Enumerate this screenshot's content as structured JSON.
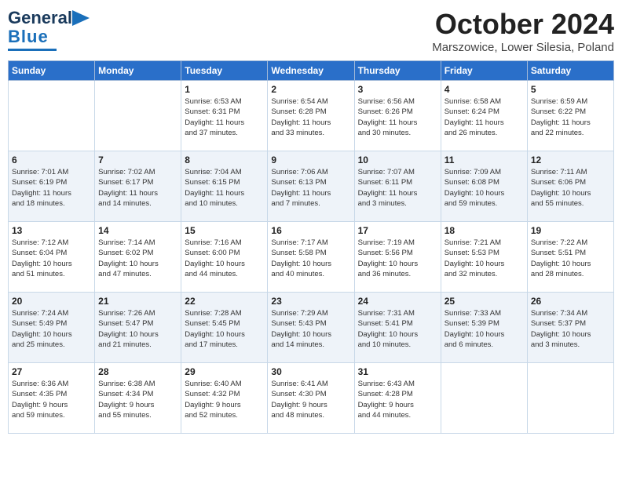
{
  "header": {
    "logo_line1": "General",
    "logo_line2": "Blue",
    "month": "October 2024",
    "location": "Marszowice, Lower Silesia, Poland"
  },
  "weekdays": [
    "Sunday",
    "Monday",
    "Tuesday",
    "Wednesday",
    "Thursday",
    "Friday",
    "Saturday"
  ],
  "weeks": [
    [
      {
        "day": "",
        "info": ""
      },
      {
        "day": "",
        "info": ""
      },
      {
        "day": "1",
        "info": "Sunrise: 6:53 AM\nSunset: 6:31 PM\nDaylight: 11 hours\nand 37 minutes."
      },
      {
        "day": "2",
        "info": "Sunrise: 6:54 AM\nSunset: 6:28 PM\nDaylight: 11 hours\nand 33 minutes."
      },
      {
        "day": "3",
        "info": "Sunrise: 6:56 AM\nSunset: 6:26 PM\nDaylight: 11 hours\nand 30 minutes."
      },
      {
        "day": "4",
        "info": "Sunrise: 6:58 AM\nSunset: 6:24 PM\nDaylight: 11 hours\nand 26 minutes."
      },
      {
        "day": "5",
        "info": "Sunrise: 6:59 AM\nSunset: 6:22 PM\nDaylight: 11 hours\nand 22 minutes."
      }
    ],
    [
      {
        "day": "6",
        "info": "Sunrise: 7:01 AM\nSunset: 6:19 PM\nDaylight: 11 hours\nand 18 minutes."
      },
      {
        "day": "7",
        "info": "Sunrise: 7:02 AM\nSunset: 6:17 PM\nDaylight: 11 hours\nand 14 minutes."
      },
      {
        "day": "8",
        "info": "Sunrise: 7:04 AM\nSunset: 6:15 PM\nDaylight: 11 hours\nand 10 minutes."
      },
      {
        "day": "9",
        "info": "Sunrise: 7:06 AM\nSunset: 6:13 PM\nDaylight: 11 hours\nand 7 minutes."
      },
      {
        "day": "10",
        "info": "Sunrise: 7:07 AM\nSunset: 6:11 PM\nDaylight: 11 hours\nand 3 minutes."
      },
      {
        "day": "11",
        "info": "Sunrise: 7:09 AM\nSunset: 6:08 PM\nDaylight: 10 hours\nand 59 minutes."
      },
      {
        "day": "12",
        "info": "Sunrise: 7:11 AM\nSunset: 6:06 PM\nDaylight: 10 hours\nand 55 minutes."
      }
    ],
    [
      {
        "day": "13",
        "info": "Sunrise: 7:12 AM\nSunset: 6:04 PM\nDaylight: 10 hours\nand 51 minutes."
      },
      {
        "day": "14",
        "info": "Sunrise: 7:14 AM\nSunset: 6:02 PM\nDaylight: 10 hours\nand 47 minutes."
      },
      {
        "day": "15",
        "info": "Sunrise: 7:16 AM\nSunset: 6:00 PM\nDaylight: 10 hours\nand 44 minutes."
      },
      {
        "day": "16",
        "info": "Sunrise: 7:17 AM\nSunset: 5:58 PM\nDaylight: 10 hours\nand 40 minutes."
      },
      {
        "day": "17",
        "info": "Sunrise: 7:19 AM\nSunset: 5:56 PM\nDaylight: 10 hours\nand 36 minutes."
      },
      {
        "day": "18",
        "info": "Sunrise: 7:21 AM\nSunset: 5:53 PM\nDaylight: 10 hours\nand 32 minutes."
      },
      {
        "day": "19",
        "info": "Sunrise: 7:22 AM\nSunset: 5:51 PM\nDaylight: 10 hours\nand 28 minutes."
      }
    ],
    [
      {
        "day": "20",
        "info": "Sunrise: 7:24 AM\nSunset: 5:49 PM\nDaylight: 10 hours\nand 25 minutes."
      },
      {
        "day": "21",
        "info": "Sunrise: 7:26 AM\nSunset: 5:47 PM\nDaylight: 10 hours\nand 21 minutes."
      },
      {
        "day": "22",
        "info": "Sunrise: 7:28 AM\nSunset: 5:45 PM\nDaylight: 10 hours\nand 17 minutes."
      },
      {
        "day": "23",
        "info": "Sunrise: 7:29 AM\nSunset: 5:43 PM\nDaylight: 10 hours\nand 14 minutes."
      },
      {
        "day": "24",
        "info": "Sunrise: 7:31 AM\nSunset: 5:41 PM\nDaylight: 10 hours\nand 10 minutes."
      },
      {
        "day": "25",
        "info": "Sunrise: 7:33 AM\nSunset: 5:39 PM\nDaylight: 10 hours\nand 6 minutes."
      },
      {
        "day": "26",
        "info": "Sunrise: 7:34 AM\nSunset: 5:37 PM\nDaylight: 10 hours\nand 3 minutes."
      }
    ],
    [
      {
        "day": "27",
        "info": "Sunrise: 6:36 AM\nSunset: 4:35 PM\nDaylight: 9 hours\nand 59 minutes."
      },
      {
        "day": "28",
        "info": "Sunrise: 6:38 AM\nSunset: 4:34 PM\nDaylight: 9 hours\nand 55 minutes."
      },
      {
        "day": "29",
        "info": "Sunrise: 6:40 AM\nSunset: 4:32 PM\nDaylight: 9 hours\nand 52 minutes."
      },
      {
        "day": "30",
        "info": "Sunrise: 6:41 AM\nSunset: 4:30 PM\nDaylight: 9 hours\nand 48 minutes."
      },
      {
        "day": "31",
        "info": "Sunrise: 6:43 AM\nSunset: 4:28 PM\nDaylight: 9 hours\nand 44 minutes."
      },
      {
        "day": "",
        "info": ""
      },
      {
        "day": "",
        "info": ""
      }
    ]
  ]
}
